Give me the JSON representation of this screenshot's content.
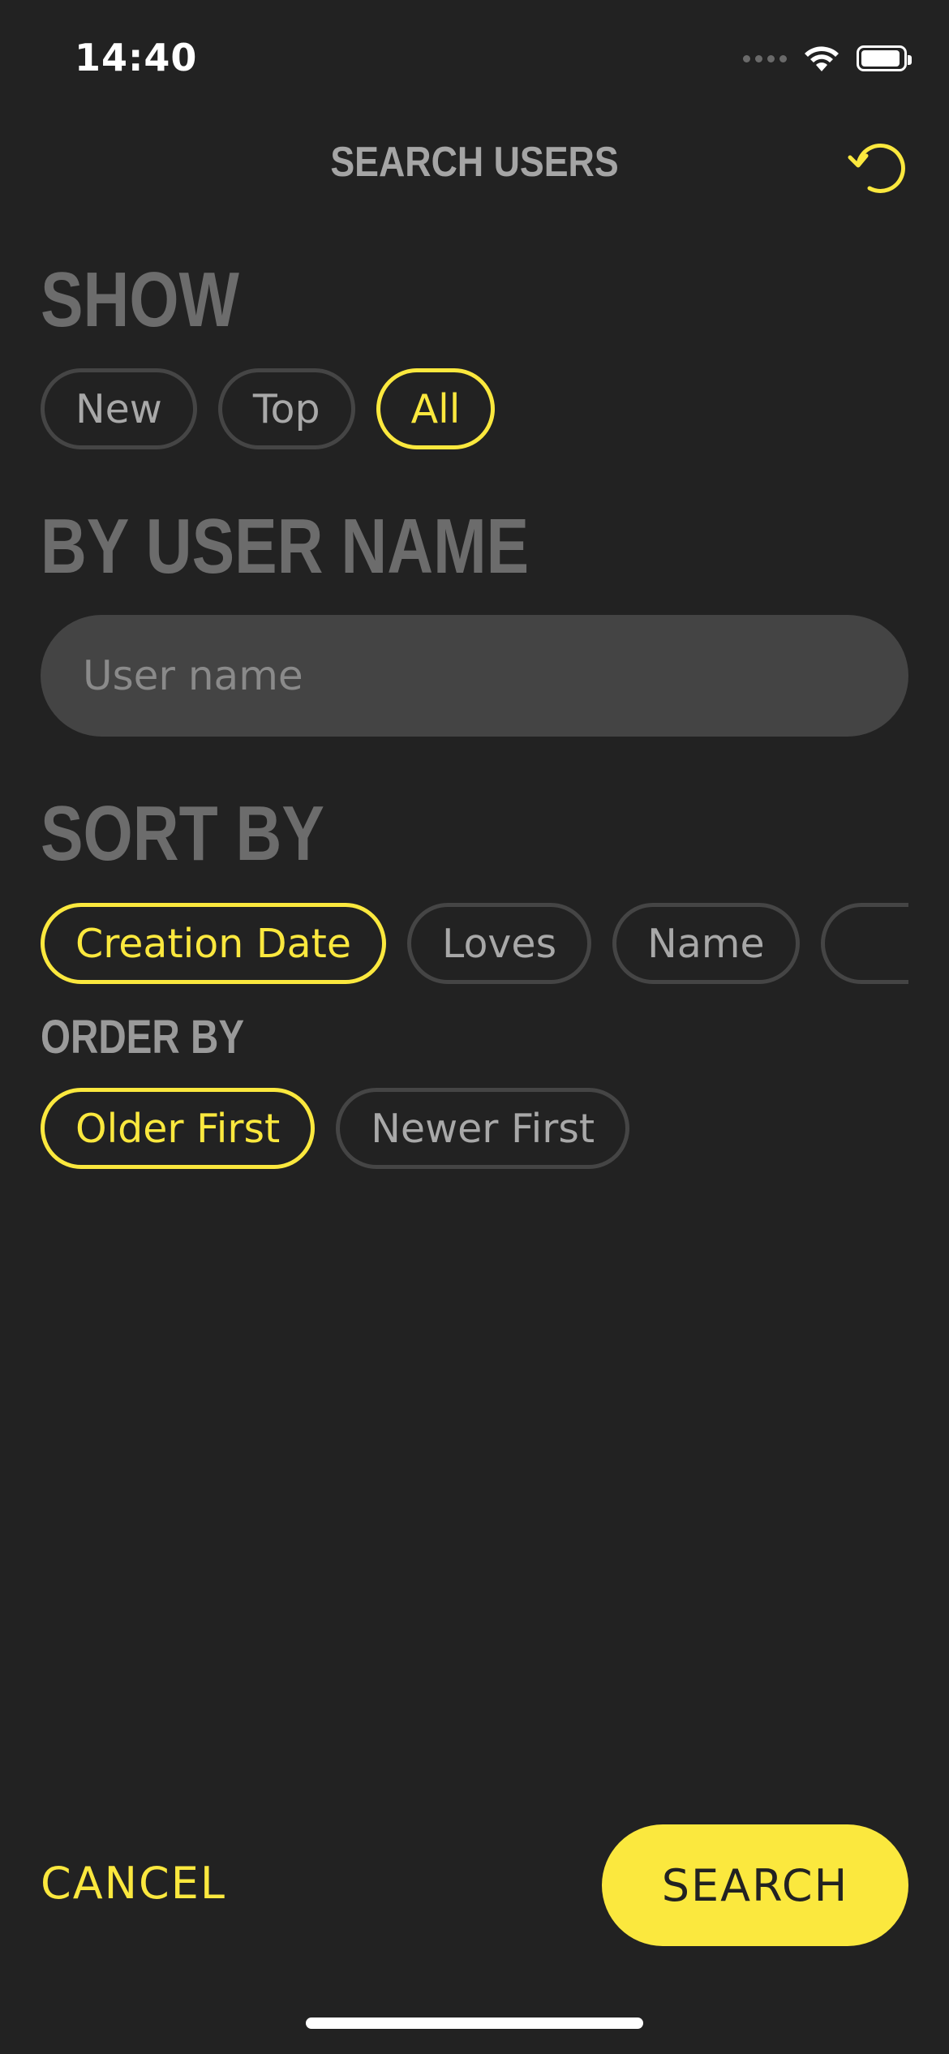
{
  "status_bar": {
    "time": "14:40",
    "icons": [
      "signal-icon",
      "wifi-icon",
      "battery-icon"
    ]
  },
  "header": {
    "title": "SEARCH USERS",
    "reset_icon": "reset-icon"
  },
  "show_section": {
    "heading": "SHOW",
    "options": [
      {
        "label": "New",
        "selected": false
      },
      {
        "label": "Top",
        "selected": false
      },
      {
        "label": "All",
        "selected": true
      }
    ]
  },
  "username_section": {
    "heading": "BY USER NAME",
    "placeholder": "User name",
    "value": ""
  },
  "sort_section": {
    "heading": "SORT BY",
    "options": [
      {
        "label": "Creation Date",
        "selected": true
      },
      {
        "label": "Loves",
        "selected": false
      },
      {
        "label": "Name",
        "selected": false
      }
    ]
  },
  "order_section": {
    "heading": "ORDER BY",
    "options": [
      {
        "label": "Older First",
        "selected": true
      },
      {
        "label": "Newer First",
        "selected": false
      }
    ]
  },
  "footer": {
    "cancel_label": "CANCEL",
    "search_label": "SEARCH"
  },
  "colors": {
    "background": "#222222",
    "accent": "#fbe83e",
    "chip_border": "#454545",
    "heading": "#6c6c6c",
    "input_bg": "#444444"
  }
}
